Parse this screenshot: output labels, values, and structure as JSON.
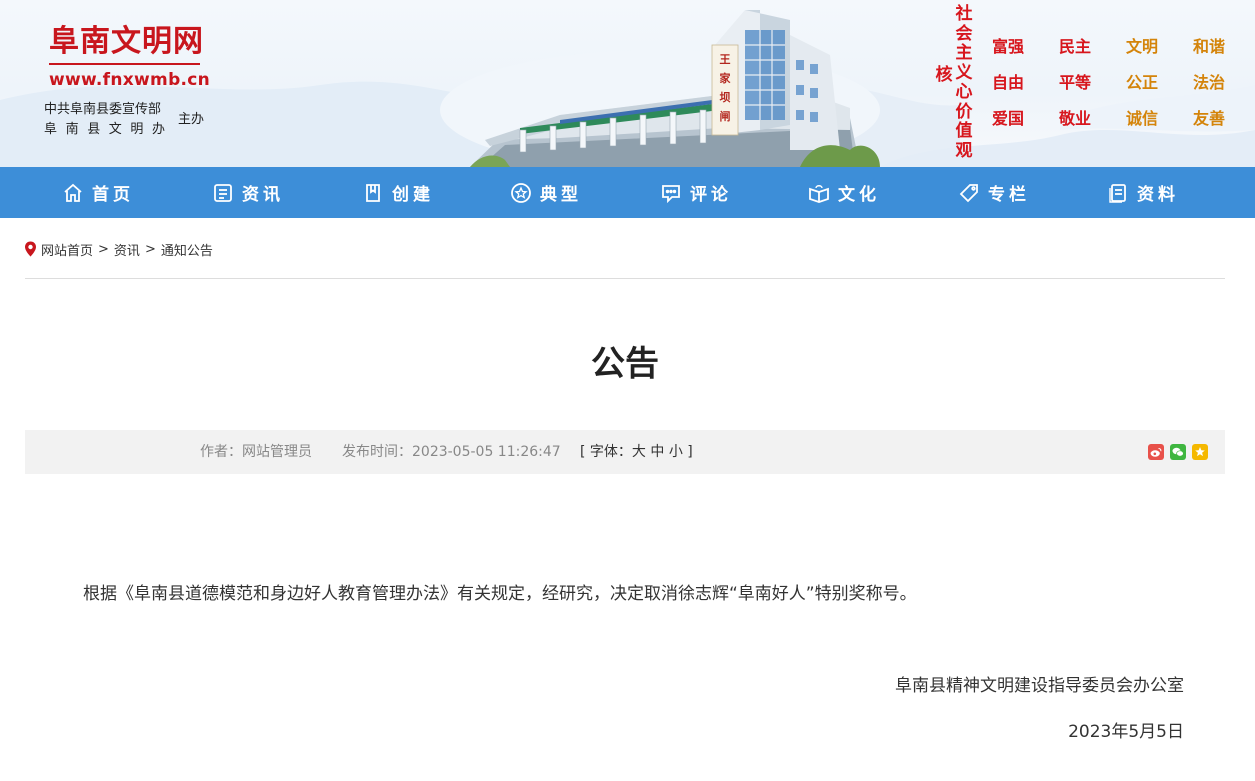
{
  "header": {
    "site_title": "阜南文明网",
    "site_url": "www.fnxwmb.cn",
    "org_line1": "中共阜南县委宣传部",
    "org_line2": "阜南县文明办",
    "org_host": "主办",
    "core_values_title": "社会主义核心价值观",
    "core_values": [
      "富强",
      "民主",
      "文明",
      "和谐",
      "自由",
      "平等",
      "公正",
      "法治",
      "爱国",
      "敬业",
      "诚信",
      "友善"
    ],
    "sign_chars": "王家坝闸"
  },
  "nav": {
    "items": [
      {
        "label": "首页",
        "icon": "home-icon"
      },
      {
        "label": "资讯",
        "icon": "news-icon"
      },
      {
        "label": "创建",
        "icon": "book-icon"
      },
      {
        "label": "典型",
        "icon": "star-icon"
      },
      {
        "label": "评论",
        "icon": "comment-icon"
      },
      {
        "label": "文化",
        "icon": "culture-book-icon"
      },
      {
        "label": "专栏",
        "icon": "tag-icon"
      },
      {
        "label": "资料",
        "icon": "document-icon"
      }
    ]
  },
  "breadcrumb": {
    "icon": "location-pin-icon",
    "home": "网站首页",
    "level1": "资讯",
    "level2": "通知公告",
    "separator": ">"
  },
  "article": {
    "title": "公告",
    "author": "作者：网站管理员",
    "publish_time": "发布时间：2023-05-05 11:26:47",
    "font_label": "[ 字体：",
    "font_large": "大",
    "font_medium": "中",
    "font_small": "小",
    "font_close": "]",
    "share_icons": [
      "weibo-icon",
      "wechat-icon",
      "favorite-icon"
    ],
    "body": "根据《阜南县道德模范和身边好人教育管理办法》有关规定，经研究，决定取消徐志辉“阜南好人”特别奖称号。",
    "signature": "阜南县精神文明建设指导委员会办公室",
    "date": "2023年5月5日"
  },
  "colors": {
    "brand_red": "#c8161d",
    "nav_blue": "#3d8ed8",
    "value_red": "#d7161d",
    "value_orange": "#d4840a"
  }
}
